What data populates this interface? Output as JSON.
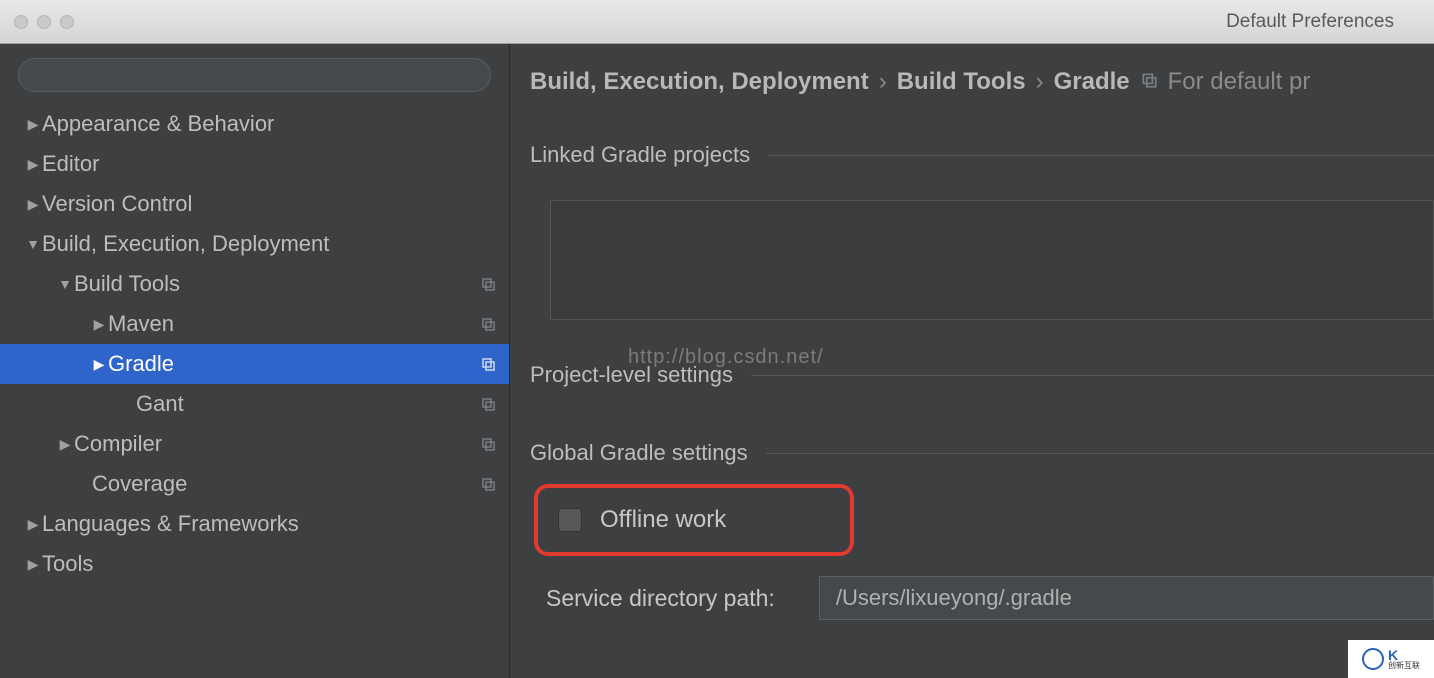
{
  "window": {
    "title": "Default Preferences"
  },
  "search": {
    "placeholder": ""
  },
  "tree": {
    "appearance": "Appearance & Behavior",
    "editor": "Editor",
    "vcs": "Version Control",
    "bed": "Build, Execution, Deployment",
    "build_tools": "Build Tools",
    "maven": "Maven",
    "gradle": "Gradle",
    "gant": "Gant",
    "compiler": "Compiler",
    "coverage": "Coverage",
    "langs": "Languages & Frameworks",
    "tools": "Tools"
  },
  "breadcrumb": {
    "seg1": "Build, Execution, Deployment",
    "seg2": "Build Tools",
    "seg3": "Gradle",
    "trail": "For default pr",
    "sep": "›"
  },
  "sections": {
    "linked": "Linked Gradle projects",
    "project_level": "Project-level settings",
    "global": "Global Gradle settings"
  },
  "offline": {
    "label": "Offline work"
  },
  "service_dir": {
    "label": "Service directory path:",
    "value": "/Users/lixueyong/.gradle"
  },
  "watermark": "http://blog.csdn.net/",
  "logo": {
    "text": "创新互联"
  }
}
